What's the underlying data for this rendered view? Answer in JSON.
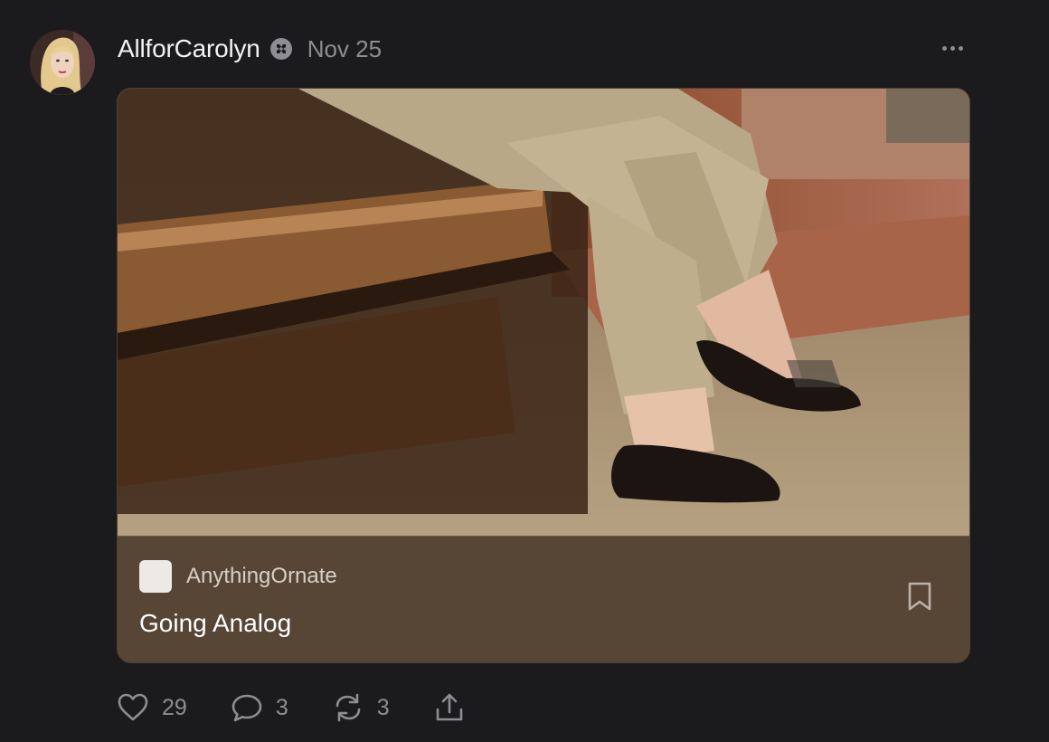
{
  "post": {
    "author": "AllforCarolyn",
    "date": "Nov 25",
    "more_icon": "more-horizontal-icon",
    "badge_icon": "subscriber-badge-icon"
  },
  "card": {
    "publication": "AnythingOrnate",
    "title": "Going Analog",
    "bookmark_icon": "bookmark-icon",
    "footer_color": "#574636"
  },
  "actions": {
    "likes": "29",
    "comments": "3",
    "restacks": "3",
    "like_icon": "heart-icon",
    "comment_icon": "comment-icon",
    "restack_icon": "restack-icon",
    "share_icon": "share-icon"
  },
  "colors": {
    "background": "#1b1b1d",
    "muted_text": "#8d8d92"
  }
}
